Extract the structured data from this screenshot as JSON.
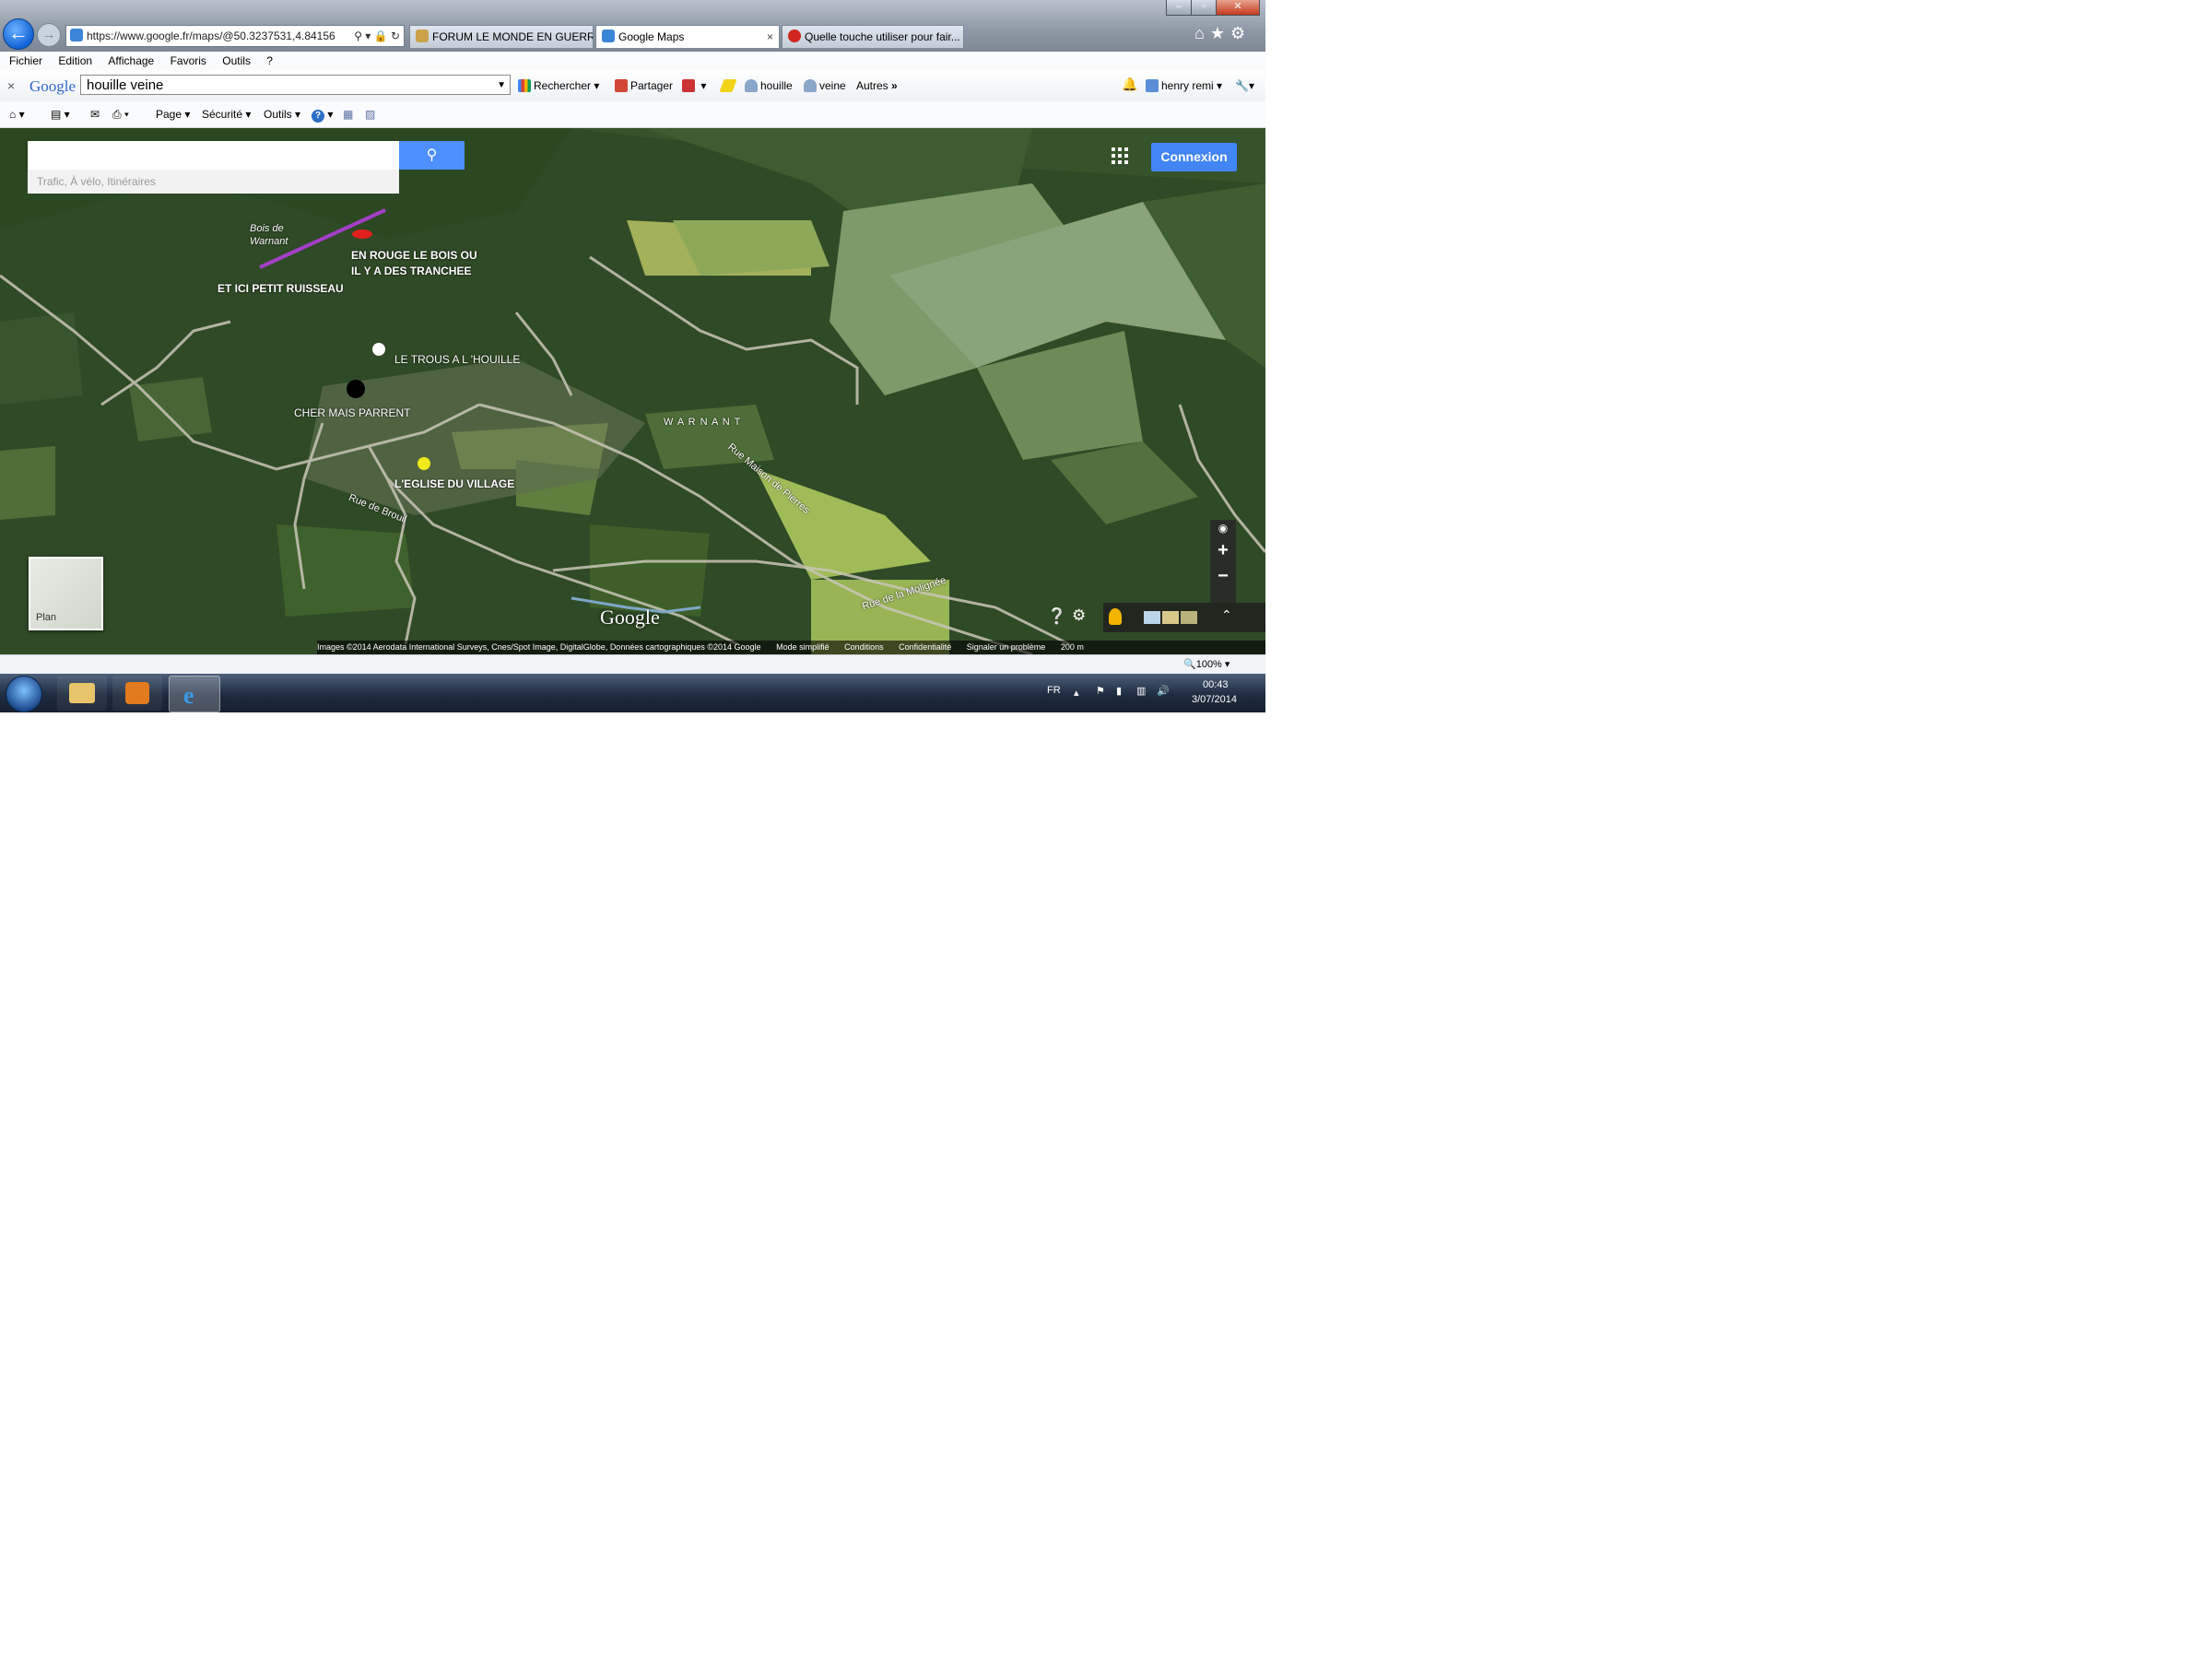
{
  "browser": {
    "url": "https://www.google.fr/maps/@50.3237531,4.84156",
    "tabs": [
      {
        "label": "FORUM LE MONDE EN GUERR...",
        "active": false,
        "color": "#c9a24a"
      },
      {
        "label": "Google Maps",
        "active": true,
        "color": "#3a85d6"
      },
      {
        "label": "Quelle touche utiliser pour fair...",
        "active": false,
        "color": "#d0281e"
      }
    ],
    "tab_close": "×",
    "window_controls": {
      "minimize": "–",
      "maximize": "▫",
      "close": "✕"
    },
    "menu": [
      "Fichier",
      "Edition",
      "Affichage",
      "Favoris",
      "Outils",
      "?"
    ]
  },
  "google_toolbar": {
    "close": "×",
    "logo": "Google",
    "query": "houille veine",
    "search_label": "Rechercher",
    "share_label": "Partager",
    "highlight1": "houille",
    "highlight2": "veine",
    "more_label": "Autres",
    "more_glyph": "»",
    "user": "henry remi"
  },
  "command_bar": {
    "page": "Page",
    "security": "Sécurité",
    "tools": "Outils",
    "help": "?"
  },
  "map": {
    "search_button_icon": "search-icon",
    "search_sub": "Trafic, À vélo, Itinéraires",
    "connexion": "Connexion",
    "plan_label": "Plan",
    "google_logo": "Google",
    "labels": {
      "bois": [
        "Bois de",
        "Warnant"
      ],
      "warnant": "W A R N A N T",
      "rue_maison": "Rue Maison de Pierres",
      "rue_moligne": "Rue de la Molignée",
      "rue_brouil": "Rue de Brouil"
    },
    "annotations": {
      "rouge_line1": "EN ROUGE LE BOIS OU",
      "rouge_line2": "IL Y A DES TRANCHEE",
      "ruisseau": "ET ICI PETIT RUISSEAU",
      "houille": "LE TROUS A L 'HOUILLE",
      "parrent": "CHER MAIS PARRENT",
      "eglise": "L'EGLISE DU VILLAGE"
    },
    "annotation_colors": {
      "purple": "#a43fc8",
      "red": "#e0201c",
      "white": "#ffffff",
      "black": "#000000",
      "yellow": "#f3e81a"
    },
    "zoom_in": "+",
    "zoom_out": "−",
    "footer": {
      "images": "Images ©2014 Aerodata International Surveys, Cnes/Spot Image, DigitalGlobe, Données cartographiques ©2014 Google",
      "mode": "Mode simplifié",
      "conditions": "Conditions",
      "confidentialite": "Confidentialité",
      "signaler": "Signaler un problème",
      "scale": "200 m"
    }
  },
  "statusbar": {
    "zoom": "100%"
  },
  "taskbar": {
    "lang": "FR",
    "time": "00:43",
    "date": "3/07/2014"
  }
}
